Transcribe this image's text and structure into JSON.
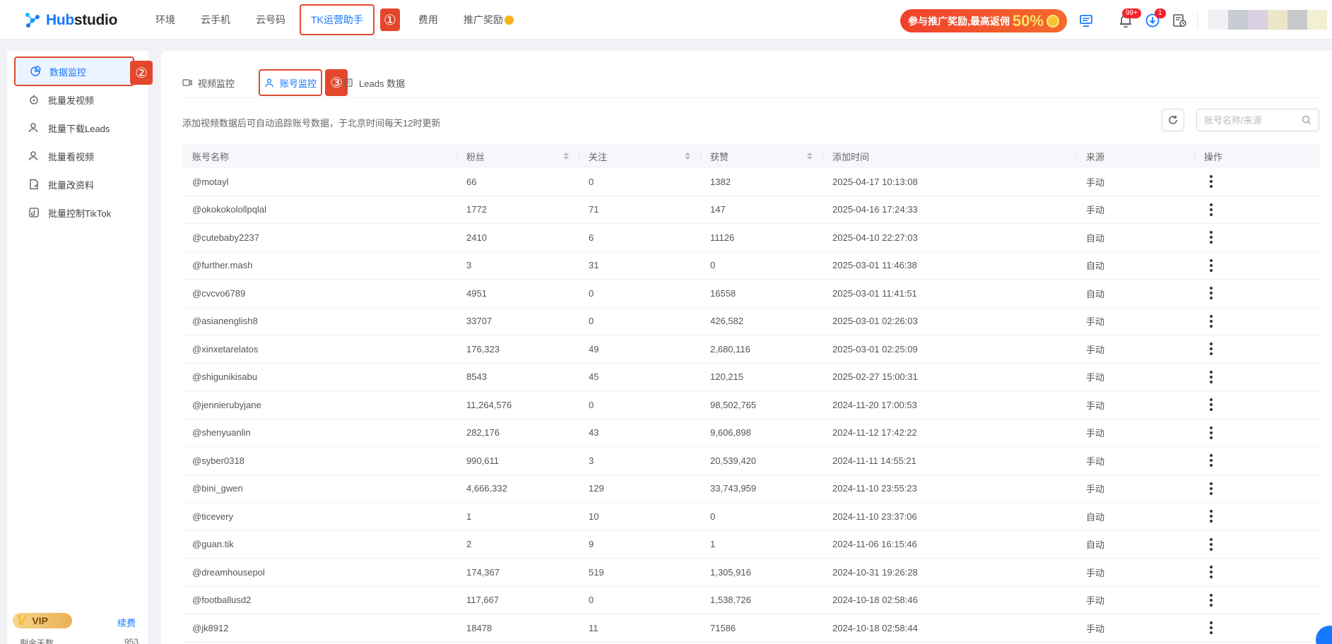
{
  "header": {
    "logo_text_a": "Hub",
    "logo_text_b": "studio",
    "nav": [
      "环境",
      "云手机",
      "云号码",
      "TK运营助手",
      "费用",
      "推广奖励"
    ],
    "active_nav": "TK运营助手",
    "nav_marker": "①",
    "promo_text": "参与推广奖励,最高返佣",
    "promo_percent": "50%",
    "notif_badge": "99+",
    "download_badge": "1"
  },
  "sidebar": {
    "items": [
      "数据监控",
      "批量发视频",
      "批量下载Leads",
      "批量看视频",
      "批量改资料",
      "批量控制TikTok"
    ],
    "marker": "②",
    "vip_label": "VIP",
    "renew": "续费",
    "days_label": "剩余天数",
    "days_value": "953"
  },
  "tabs": {
    "items": [
      "视频监控",
      "账号监控",
      "Leads 数据"
    ],
    "marker": "③"
  },
  "hint": "添加视频数据后可自动追踪账号数据，于北京时间每天12时更新",
  "search": {
    "placeholder": "账号名称/来源"
  },
  "table": {
    "headers": [
      "账号名称",
      "粉丝",
      "关注",
      "获赞",
      "添加时间",
      "来源",
      "操作"
    ],
    "rows": [
      [
        "@motayl",
        "66",
        "0",
        "1382",
        "2025-04-17 10:13:08",
        "手动"
      ],
      [
        "@okokokolollpqlal",
        "1772",
        "71",
        "147",
        "2025-04-16 17:24:33",
        "手动"
      ],
      [
        "@cutebaby2237",
        "2410",
        "6",
        "11126",
        "2025-04-10 22:27:03",
        "自动"
      ],
      [
        "@further.mash",
        "3",
        "31",
        "0",
        "2025-03-01 11:46:38",
        "自动"
      ],
      [
        "@cvcvo6789",
        "4951",
        "0",
        "16558",
        "2025-03-01 11:41:51",
        "自动"
      ],
      [
        "@asianenglish8",
        "33707",
        "0",
        "426,582",
        "2025-03-01 02:26:03",
        "手动"
      ],
      [
        "@xinxetarelatos",
        "176,323",
        "49",
        "2,680,116",
        "2025-03-01 02:25:09",
        "手动"
      ],
      [
        "@shigunikisabu",
        "8543",
        "45",
        "120,215",
        "2025-02-27 15:00:31",
        "手动"
      ],
      [
        "@jennierubyjane",
        "11,264,576",
        "0",
        "98,502,765",
        "2024-11-20 17:00:53",
        "手动"
      ],
      [
        "@shenyuanlin",
        "282,176",
        "43",
        "9,606,898",
        "2024-11-12 17:42:22",
        "手动"
      ],
      [
        "@syber0318",
        "990,611",
        "3",
        "20,539,420",
        "2024-11-11 14:55:21",
        "手动"
      ],
      [
        "@bini_gwen",
        "4,666,332",
        "129",
        "33,743,959",
        "2024-11-10 23:55:23",
        "手动"
      ],
      [
        "@ticevery",
        "1",
        "10",
        "0",
        "2024-11-10 23:37:06",
        "自动"
      ],
      [
        "@guan.tik",
        "2",
        "9",
        "1",
        "2024-11-06 16:15:46",
        "自动"
      ],
      [
        "@dreamhousepol",
        "174,367",
        "519",
        "1,305,916",
        "2024-10-31 19:26:28",
        "手动"
      ],
      [
        "@footballusd2",
        "117,667",
        "0",
        "1,538,726",
        "2024-10-18 02:58:46",
        "手动"
      ],
      [
        "@jk8912",
        "18478",
        "11",
        "71586",
        "2024-10-18 02:58:44",
        "手动"
      ]
    ]
  }
}
